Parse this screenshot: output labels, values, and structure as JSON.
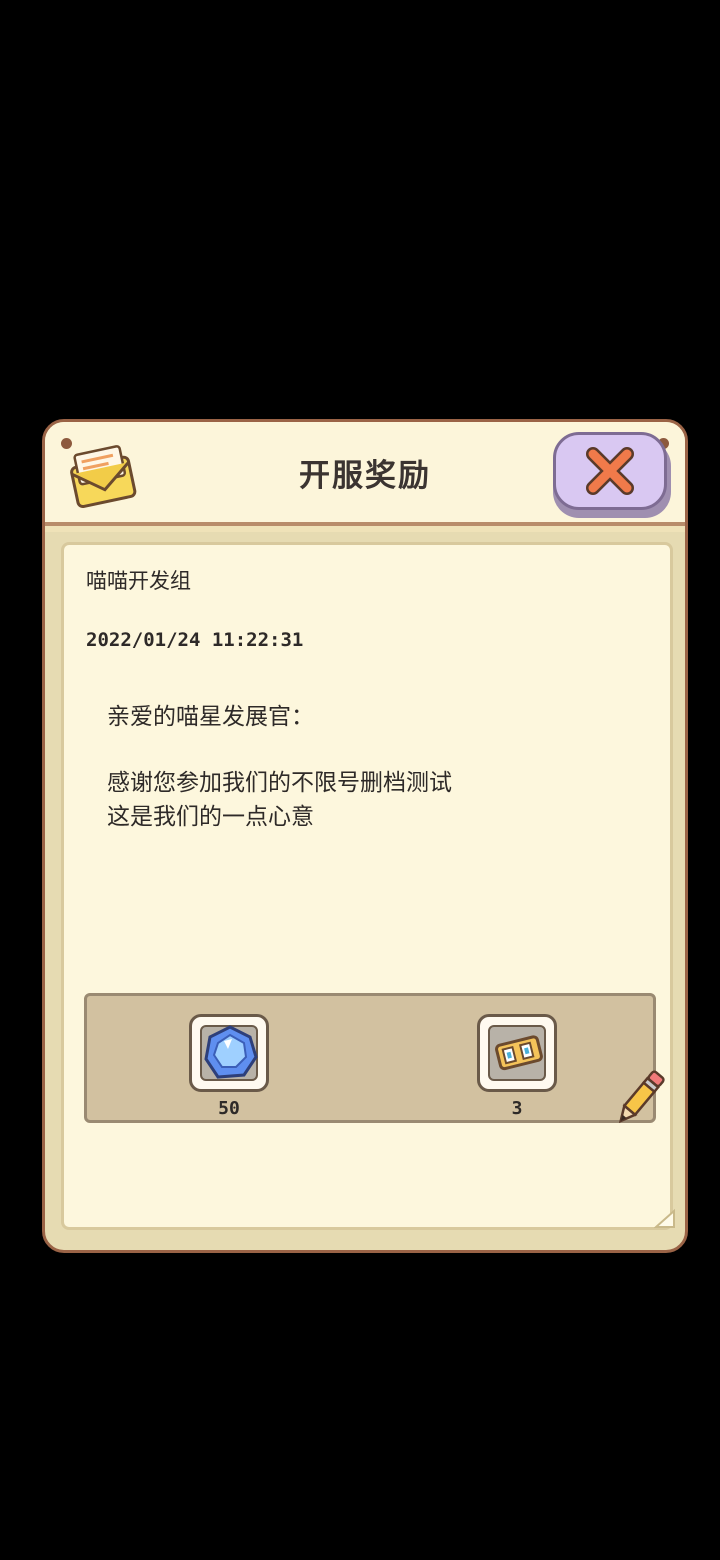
{
  "dialog": {
    "title": "开服奖励",
    "header_icon": "envelope-icon",
    "close_icon": "close-icon"
  },
  "mail": {
    "sender": "喵喵开发组",
    "date": "2022/01/24 11:22:31",
    "greeting": "亲爱的喵星发展官：",
    "lines": [
      "感谢您参加我们的不限号删档测试",
      "这是我们的一点心意"
    ]
  },
  "rewards": [
    {
      "icon": "blue-gem-icon",
      "quantity": "50"
    },
    {
      "icon": "ticket-icon",
      "quantity": "3"
    }
  ],
  "colors": {
    "background": "#000000",
    "panel": "#fcf5da",
    "border": "#9a6346",
    "close_button": "#d9c8f2",
    "close_x": "#f07a4a"
  }
}
